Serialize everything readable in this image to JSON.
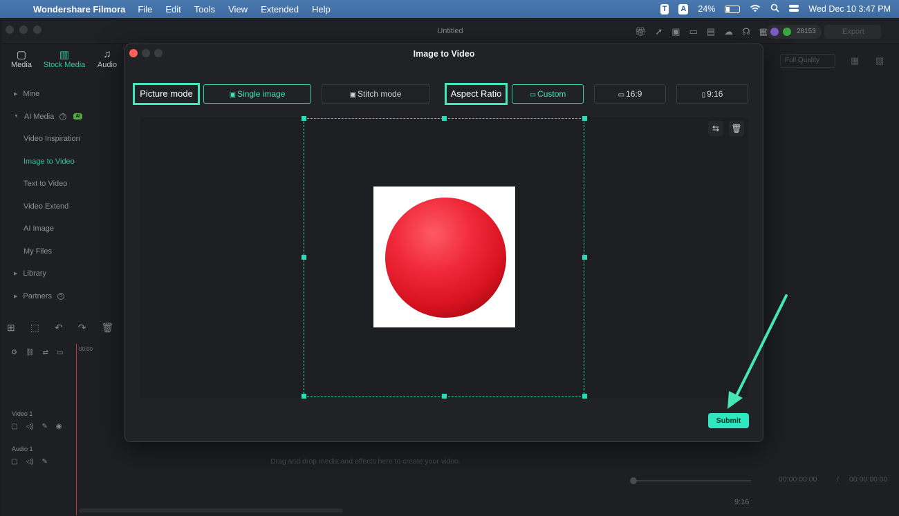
{
  "menubar": {
    "app_name": "Wondershare Filmora",
    "menus": [
      "File",
      "Edit",
      "Tools",
      "View",
      "Extended",
      "Help"
    ],
    "input_indicator_1": "T",
    "input_indicator_2": "A",
    "battery": "24%",
    "datetime": "Wed Dec 10  3:47 PM"
  },
  "window": {
    "title": "Untitled",
    "credits": "28153",
    "export_label": "Export",
    "quality": "Full Quality"
  },
  "main_tabs": [
    {
      "label": "Media"
    },
    {
      "label": "Stock Media"
    },
    {
      "label": "Audio"
    }
  ],
  "sidebar": {
    "items": [
      {
        "label": "Mine"
      },
      {
        "label": "AI Media",
        "badge": "AI"
      },
      {
        "label": "Video Inspiration"
      },
      {
        "label": "Image to Video"
      },
      {
        "label": "Text to Video"
      },
      {
        "label": "Video Extend"
      },
      {
        "label": "AI Image"
      },
      {
        "label": "My Files"
      },
      {
        "label": "Library"
      },
      {
        "label": "Partners"
      }
    ]
  },
  "timeline": {
    "ruler_start": "00:00",
    "video_track": "Video 1",
    "audio_track": "Audio 1",
    "drop_message": "Drag and drop media and effects here to create your video.",
    "current_time": "00:00:00:00",
    "separator": "/",
    "total_time": "00:00:00:00",
    "ratio": "9:16"
  },
  "modal": {
    "title": "Image to Video",
    "picture_mode_label": "Picture mode",
    "single_image_label": "Single image",
    "stitch_mode_label": "Stitch mode",
    "aspect_ratio_label": "Aspect Ratio",
    "custom_label": "Custom",
    "ratio_16_9_label": "16:9",
    "ratio_9_16_label": "9:16",
    "submit_label": "Submit",
    "accent_color": "#2ee6bf"
  }
}
